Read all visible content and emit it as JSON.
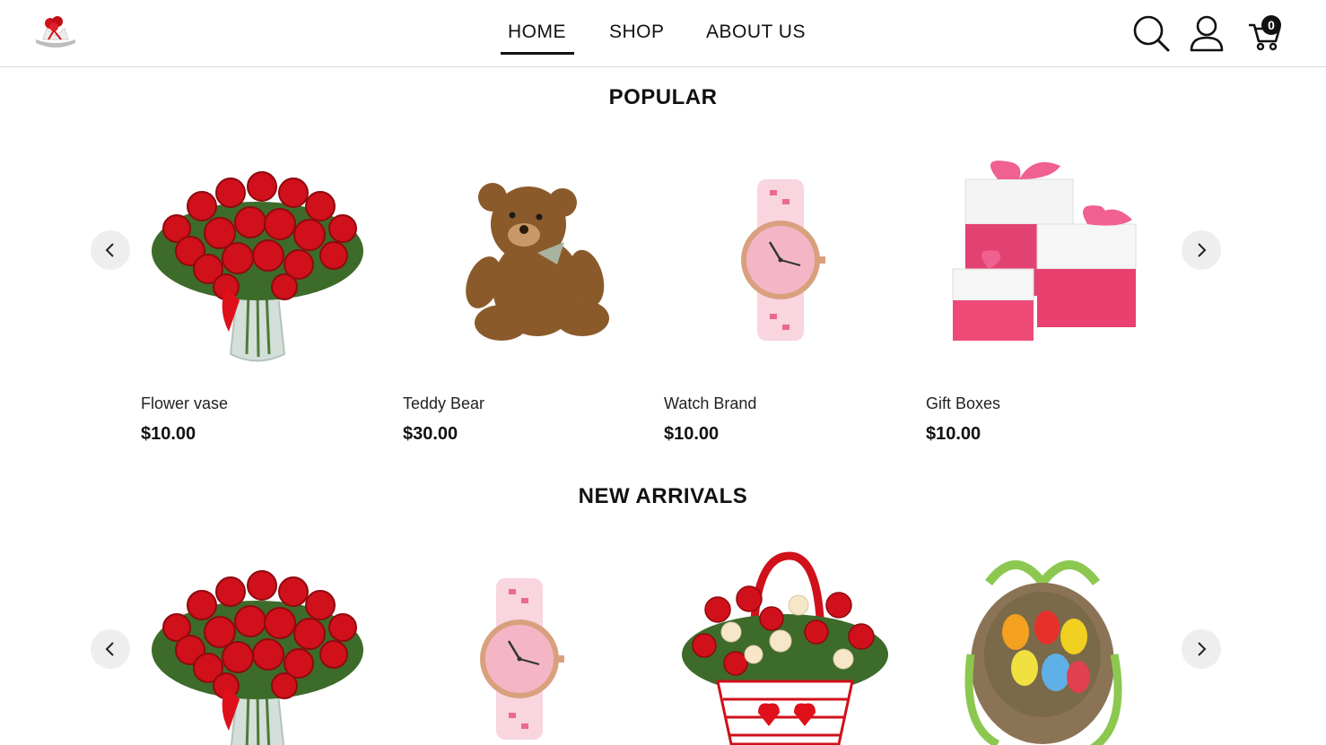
{
  "header": {
    "logo_icon": "gift-logo-icon",
    "nav": [
      {
        "label": "HOME",
        "active": true
      },
      {
        "label": "SHOP",
        "active": false
      },
      {
        "label": "ABOUT US",
        "active": false
      }
    ],
    "icons": [
      "search-icon",
      "user-icon",
      "cart-icon"
    ],
    "cart_count": "0"
  },
  "popular": {
    "title": "POPULAR",
    "products": [
      {
        "name": "Flower vase",
        "price": "$10.00",
        "image": "red-roses-vase"
      },
      {
        "name": "Teddy Bear",
        "price": "$30.00",
        "image": "teddy-bear"
      },
      {
        "name": "Watch Brand",
        "price": "$10.00",
        "image": "pink-watch"
      },
      {
        "name": "Gift Boxes",
        "price": "$10.00",
        "image": "pink-gift-boxes"
      }
    ]
  },
  "new_arrivals": {
    "title": "NEW ARRIVALS",
    "products": [
      {
        "image": "red-roses-vase"
      },
      {
        "image": "pink-watch"
      },
      {
        "image": "flower-basket"
      },
      {
        "image": "easter-egg-basket"
      }
    ]
  },
  "colors": {
    "accent": "#111111",
    "rose_red": "#d0101a",
    "pink": "#e8527a",
    "arrow_bg": "#eeeeee"
  }
}
